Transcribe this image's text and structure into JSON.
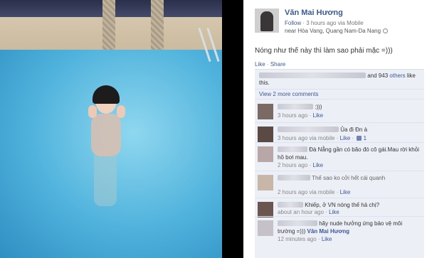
{
  "post": {
    "author": "Văn Mai Hương",
    "follow": "Follow",
    "time_via": "· 3 hours ago via Mobile",
    "location": "near Hòa Vang, Quang Nam-Da Nang",
    "caption": "Nóng như thế này thì làm sao phải mặc =)))",
    "like_label": "Like",
    "share_label": "Share"
  },
  "likes": {
    "text_pre": "and 943",
    "others": "others",
    "text_post": "like this."
  },
  "view_more": "View 2 more comments",
  "comments": [
    {
      "text": ":)))",
      "time": "3 hours ago",
      "like": "Like",
      "likes_count": ""
    },
    {
      "text": "Ủa đi Đn à",
      "time": "3 hours ago via mobile",
      "like": "Like",
      "likes_count": "1"
    },
    {
      "text": "Đà Nẵng gần có bão đó cô gái.Mau rời khỏi hồ bơi mau.",
      "time": "2 hours ago",
      "like": "Like",
      "likes_count": ""
    },
    {
      "text": "Thế sao ko cởi hết cái quanh",
      "time": "2 hours ago via mobile",
      "like": "Like",
      "likes_count": ""
    },
    {
      "text": "Khiếp, ở VN nóng thế hả chị?",
      "time": "about an hour ago",
      "like": "Like",
      "likes_count": ""
    },
    {
      "text": "hãy nude hưởng ứng bảo vệ môi trường =))) ",
      "mention": "Văn Mai Hương",
      "time": "12 minutes ago",
      "like": "Like",
      "likes_count": ""
    }
  ],
  "colors": {
    "link": "#3b5998",
    "ufi_bg": "#eceff5",
    "water": "#4fb2dc"
  }
}
